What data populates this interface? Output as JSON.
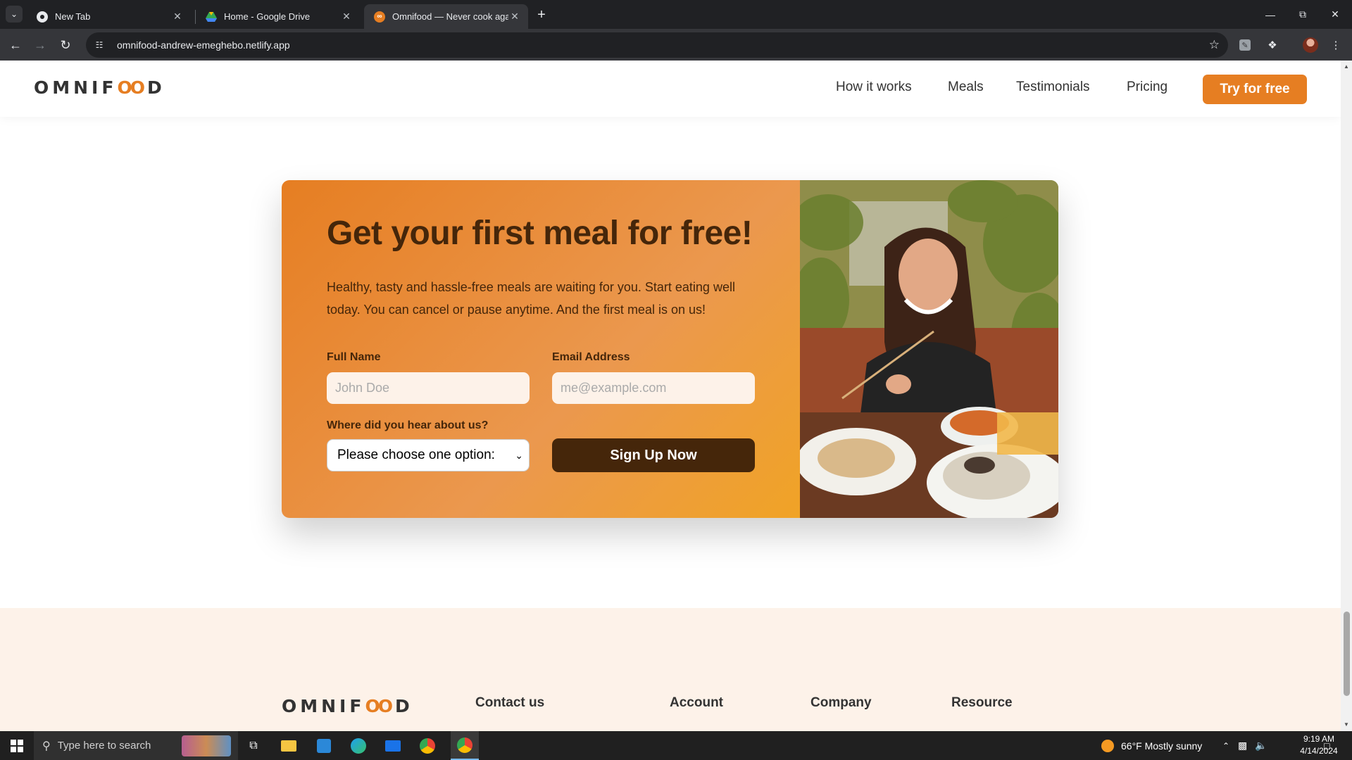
{
  "browser": {
    "tabs": [
      {
        "title": "New Tab"
      },
      {
        "title": "Home - Google Drive"
      },
      {
        "title": "Omnifood — Never cook again!"
      }
    ],
    "url": "omnifood-andrew-emeghebo.netlify.app"
  },
  "site": {
    "logo_left": "OMNIF",
    "logo_oo": "OO",
    "logo_right": "D",
    "nav": [
      "How it works",
      "Meals",
      "Testimonials",
      "Pricing"
    ],
    "nav_cta": "Try for free"
  },
  "cta": {
    "title": "Get your first meal for free!",
    "text": "Healthy, tasty and hassle-free meals are waiting for you. Start eating well today. You can cancel or pause anytime. And the first meal is on us!",
    "full_name_label": "Full Name",
    "full_name_placeholder": "John Doe",
    "email_label": "Email Address",
    "email_placeholder": "me@example.com",
    "source_label": "Where did you hear about us?",
    "source_selected": "Please choose one option:",
    "submit_label": "Sign Up Now"
  },
  "footer": {
    "headings": [
      "Contact us",
      "Account",
      "Company",
      "Resource"
    ]
  },
  "taskbar": {
    "search_placeholder": "Type here to search",
    "weather": "66°F  Mostly sunny",
    "time": "9:19 AM",
    "date": "4/14/2024"
  },
  "colors": {
    "brand": "#e67e22",
    "brand_dark": "#45260a",
    "footer_bg": "#fdf2e9"
  }
}
